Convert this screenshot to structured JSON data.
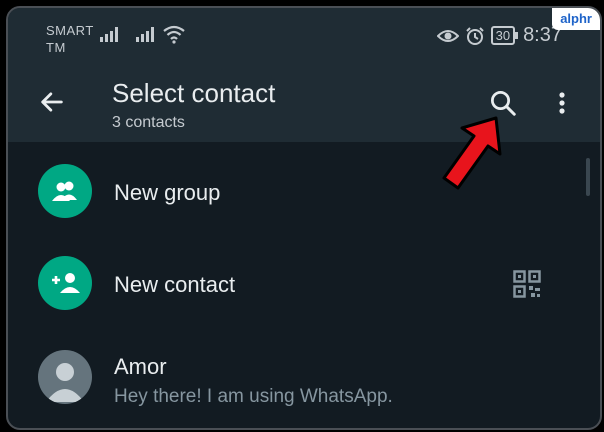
{
  "statusbar": {
    "carrier_line1": "SMART",
    "carrier_line2": "TM",
    "battery": "30",
    "time": "8:37"
  },
  "watermark": "alphr",
  "appbar": {
    "title": "Select contact",
    "subtitle": "3 contacts"
  },
  "list": {
    "new_group": "New group",
    "new_contact": "New contact",
    "contacts": [
      {
        "name": "Amor",
        "status": "Hey there! I am using WhatsApp."
      }
    ]
  },
  "colors": {
    "accent": "#00a884",
    "bar": "#1f2c34",
    "background": "#121b22",
    "annotation_arrow": "#e8141c"
  },
  "icons": [
    "signal-icon",
    "wifi-icon",
    "eye-icon",
    "alarm-icon",
    "battery-icon",
    "back-arrow-icon",
    "search-icon",
    "more-vert-icon",
    "group-icon",
    "add-contact-icon",
    "qr-code-icon",
    "default-avatar-icon",
    "annotation-arrow"
  ]
}
